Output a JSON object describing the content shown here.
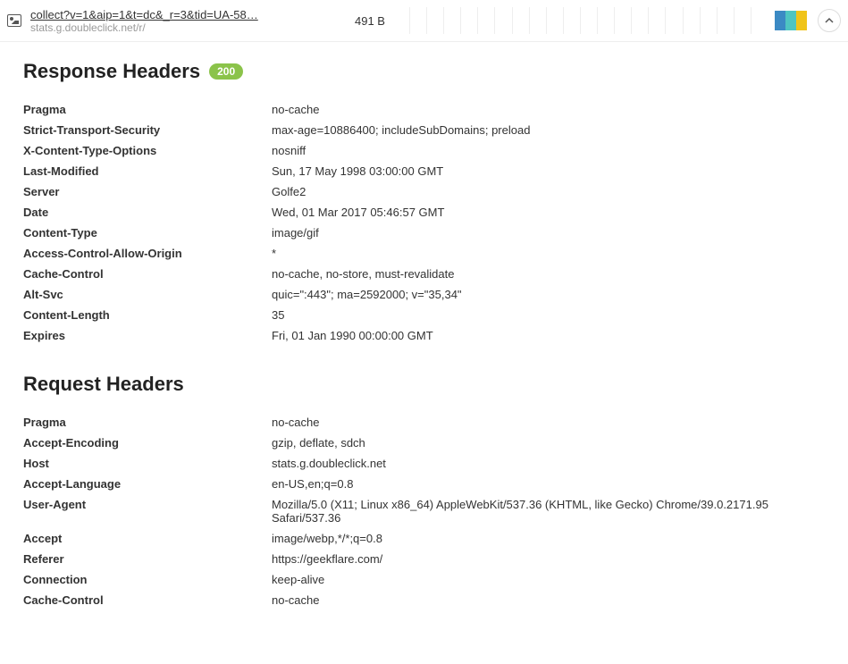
{
  "request": {
    "url": "collect?v=1&aip=1&t=dc&_r=3&tid=UA-58…",
    "host": "stats.g.doubleclick.net/r/",
    "size": "491 B"
  },
  "response": {
    "title": "Response Headers",
    "status": "200",
    "headers": [
      {
        "name": "Pragma",
        "value": "no-cache"
      },
      {
        "name": "Strict-Transport-Security",
        "value": "max-age=10886400; includeSubDomains; preload"
      },
      {
        "name": "X-Content-Type-Options",
        "value": "nosniff"
      },
      {
        "name": "Last-Modified",
        "value": "Sun, 17 May 1998 03:00:00 GMT"
      },
      {
        "name": "Server",
        "value": "Golfe2"
      },
      {
        "name": "Date",
        "value": "Wed, 01 Mar 2017 05:46:57 GMT"
      },
      {
        "name": "Content-Type",
        "value": "image/gif"
      },
      {
        "name": "Access-Control-Allow-Origin",
        "value": "*"
      },
      {
        "name": "Cache-Control",
        "value": "no-cache, no-store, must-revalidate"
      },
      {
        "name": "Alt-Svc",
        "value": "quic=\":443\"; ma=2592000; v=\"35,34\""
      },
      {
        "name": "Content-Length",
        "value": "35"
      },
      {
        "name": "Expires",
        "value": "Fri, 01 Jan 1990 00:00:00 GMT"
      }
    ]
  },
  "requestHeaders": {
    "title": "Request Headers",
    "headers": [
      {
        "name": "Pragma",
        "value": "no-cache"
      },
      {
        "name": "Accept-Encoding",
        "value": "gzip, deflate, sdch"
      },
      {
        "name": "Host",
        "value": "stats.g.doubleclick.net"
      },
      {
        "name": "Accept-Language",
        "value": "en-US,en;q=0.8"
      },
      {
        "name": "User-Agent",
        "value": "Mozilla/5.0 (X11; Linux x86_64) AppleWebKit/537.36 (KHTML, like Gecko) Chrome/39.0.2171.95 Safari/537.36"
      },
      {
        "name": "Accept",
        "value": "image/webp,*/*;q=0.8"
      },
      {
        "name": "Referer",
        "value": "https://geekflare.com/"
      },
      {
        "name": "Connection",
        "value": "keep-alive"
      },
      {
        "name": "Cache-Control",
        "value": "no-cache"
      }
    ]
  }
}
